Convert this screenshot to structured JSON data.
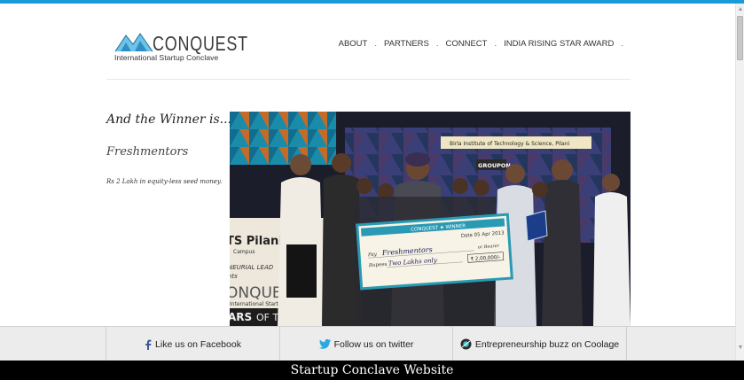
{
  "logo": {
    "title": "CONQUEST",
    "subtitle": "International Startup Conclave"
  },
  "nav": {
    "items": [
      "ABOUT",
      "PARTNERS",
      "CONNECT",
      "INDIA RISING STAR AWARD"
    ],
    "separator": "."
  },
  "main": {
    "heading": "And the Winner is....",
    "winner": "Freshmentors",
    "prize": "Rs 2 Lakh in equity-less seed money."
  },
  "photo": {
    "backdrop_text": "Birla Institute of Technology & Science, Pilani",
    "sponsor": "GROUPON",
    "bits": "TS Pilani",
    "campus": "Campus",
    "event": "NEURIAL LEAD",
    "events_word": "nts",
    "conquest": "ONQUEST",
    "year": "2013",
    "intl": "International Startup Conclave",
    "stars": "ARS",
    "of_the": "OF THE L",
    "cheque_head": "CONQUEST ★ WINNER",
    "cheque_date": "Date 05 Apr 2013",
    "cheque_pay_label": "Pay",
    "cheque_pay": "Freshmentors",
    "cheque_or_bearer": "or Bearer",
    "cheque_rupees_label": "Rupees",
    "cheque_rupees": "Two Lakhs only",
    "cheque_amount": "₹ 2,00,000/-"
  },
  "footer": {
    "facebook": "Like us on Facebook",
    "twitter": "Follow us on twitter",
    "coolage": "Entrepreneurship buzz on Coolage"
  },
  "caption": "Startup Conclave Website",
  "colors": {
    "accent": "#1a9ad6",
    "facebook": "#3b5998",
    "twitter": "#2aa9e0"
  }
}
